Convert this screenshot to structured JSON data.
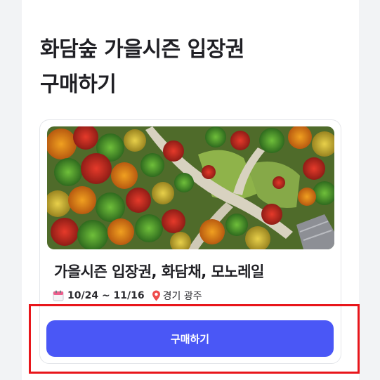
{
  "page": {
    "title_line1": "화담숲 가을시즌 입장권",
    "title_line2": "구매하기"
  },
  "ticket_card": {
    "image_icon": "autumn-forest-aerial-photo",
    "title": "가을시즌 입장권, 화담채, 모노레일",
    "date_range": "10/24 ~ 11/16",
    "location": "경기 광주",
    "calendar_icon": "calendar-icon",
    "location_icon": "location-pin-icon"
  },
  "buy_button": {
    "label": "구매하기"
  },
  "colors": {
    "accent": "#4a57f6",
    "highlight": "#e8161b",
    "title_text": "#1f1f24"
  }
}
